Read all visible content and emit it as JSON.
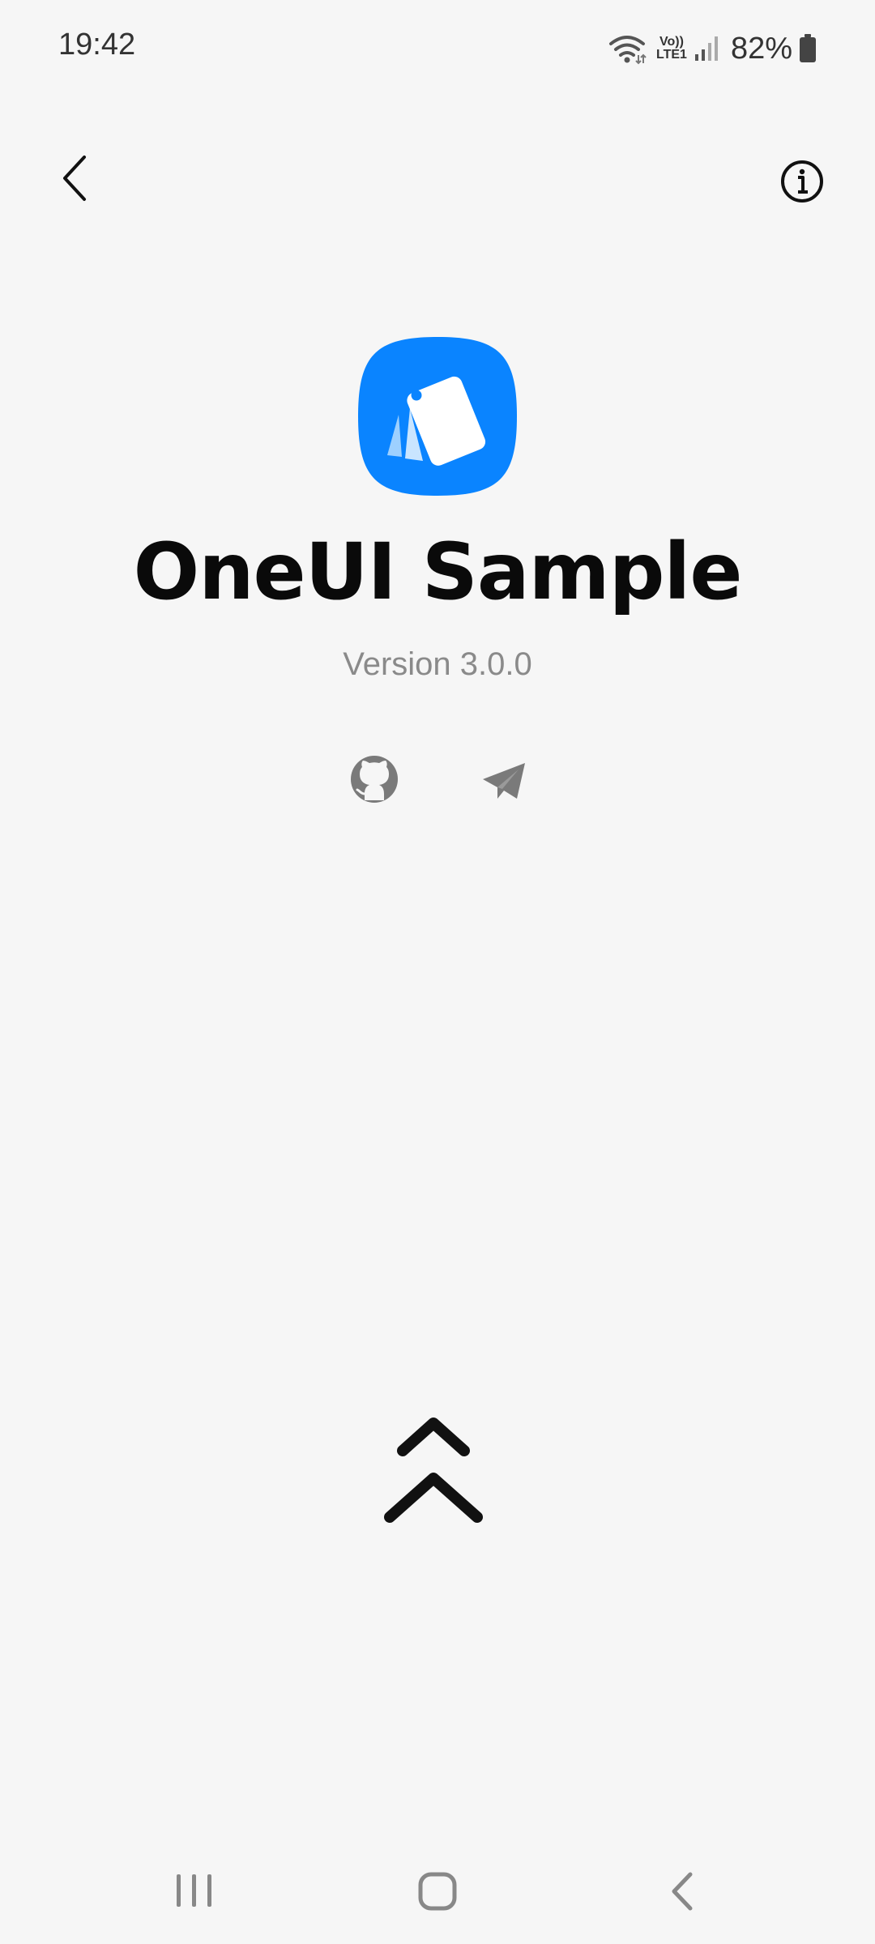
{
  "status_bar": {
    "time": "19:42",
    "network_top": "Vo))",
    "network_bottom": "LTE1",
    "battery": "82%",
    "icons": [
      "wifi-icon",
      "signal-icon",
      "battery-icon"
    ]
  },
  "toolbar": {
    "back_icon": "back-arrow-icon",
    "info_icon": "info-icon"
  },
  "app": {
    "name": "OneUI Sample",
    "version": "Version 3.0.0",
    "icon": "app-logo-icon",
    "accent_color": "#0a84ff"
  },
  "links": [
    {
      "icon": "github-icon"
    },
    {
      "icon": "telegram-icon"
    }
  ],
  "scroll_hint_icon": "double-chevron-up-icon",
  "navigation": {
    "icons": [
      "recent-apps-icon",
      "home-icon",
      "back-icon"
    ]
  }
}
